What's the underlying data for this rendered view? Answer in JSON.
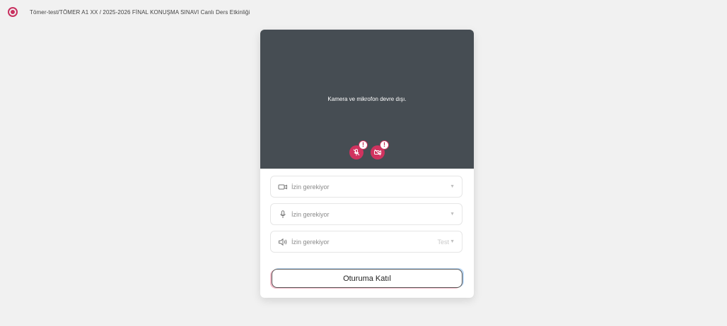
{
  "header": {
    "breadcrumb": "Tömer-test/TÖMER A1 XX / 2025-2026 FİNAL KONUŞMA SINAVI Canlı Ders Etkinliği",
    "logo_icon": "app-logo-icon"
  },
  "preview": {
    "message": "Kamera ve mikrofon devre dışı.",
    "badges": [
      {
        "icon": "microphone-off-icon",
        "warning": "!"
      },
      {
        "icon": "camera-off-icon",
        "warning": "!"
      }
    ]
  },
  "devices": {
    "camera": {
      "label": "İzin gerekiyor",
      "icon": "camera-icon",
      "caret": "▼"
    },
    "microphone": {
      "label": "İzin gerekiyor",
      "icon": "microphone-icon",
      "caret": "▼"
    },
    "speaker": {
      "label": "İzin gerekiyor",
      "icon": "speaker-icon",
      "test_label": "Test",
      "caret": "▼"
    }
  },
  "actions": {
    "join_label": "Oturuma Katıl"
  },
  "colors": {
    "accent": "#d0335f",
    "preview_bg": "#464d53",
    "page_bg": "#f1f1f1"
  }
}
